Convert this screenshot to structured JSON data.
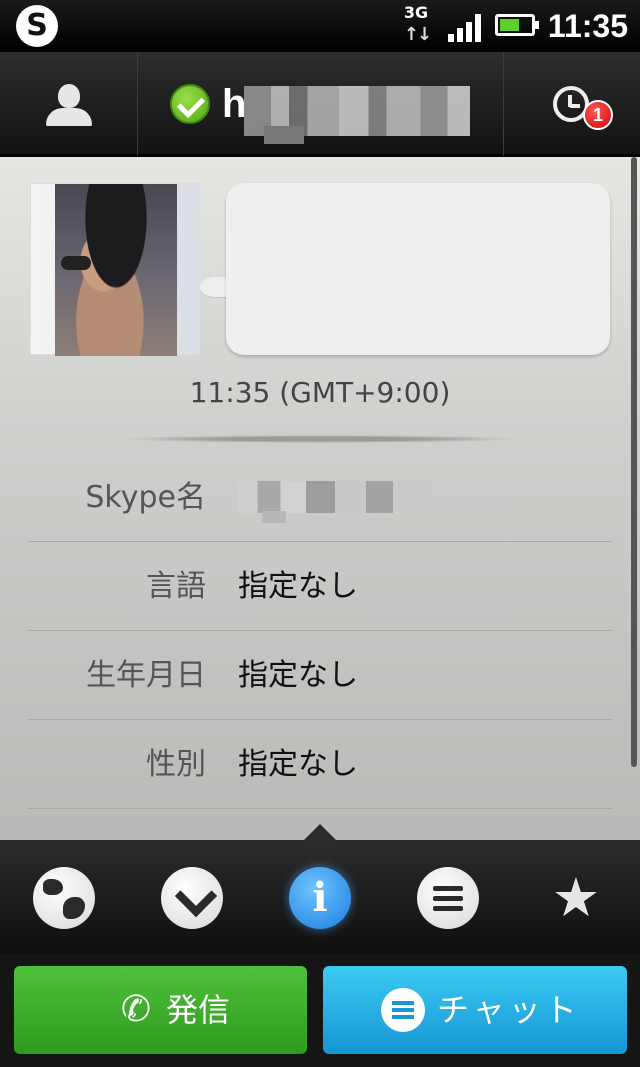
{
  "status_bar": {
    "network": "3G",
    "network_arrows": "↑↓",
    "time": "11:35",
    "app_icon": "S"
  },
  "header": {
    "contact_name": "h",
    "status_color": "#5cb82a",
    "history_badge": "1"
  },
  "profile": {
    "local_time": "11:35 (GMT+9:00)",
    "rows": [
      {
        "label": "Skype名",
        "value": ""
      },
      {
        "label": "言語",
        "value": "指定なし"
      },
      {
        "label": "生年月日",
        "value": "指定なし"
      },
      {
        "label": "性別",
        "value": "指定なし"
      }
    ]
  },
  "nav": {
    "items": [
      "globe-icon",
      "diamond-icon",
      "info-icon",
      "chat-list-icon",
      "star-icon"
    ],
    "info_glyph": "i",
    "star_glyph": "★",
    "active": "info-icon"
  },
  "actions": {
    "call_label": "発信",
    "call_icon": "✆",
    "chat_label": "チャット"
  },
  "colors": {
    "call_green": "#3aab28",
    "chat_blue": "#22aee3",
    "badge_red": "#d40000"
  }
}
